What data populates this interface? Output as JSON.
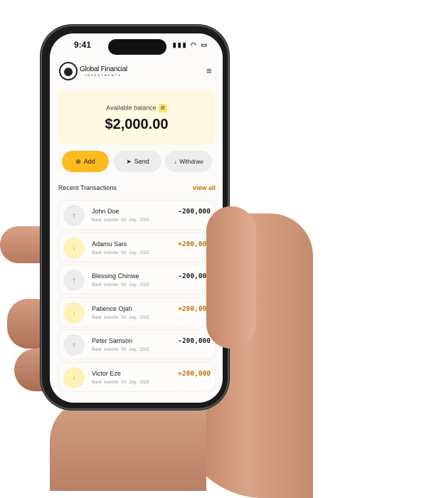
{
  "status": {
    "time": "9:41",
    "icons": "▮▮▮ ◠ ▭"
  },
  "header": {
    "brand": "Global Financial",
    "brand_sub": "INVESTMENTS"
  },
  "balance": {
    "label": "Available balance",
    "eye": "⊘",
    "amount": "$2,000.00"
  },
  "actions": {
    "add": "Add",
    "add_icon": "⊕",
    "send": "Send",
    "send_icon": "➤",
    "withdraw": "Withdraw",
    "withdraw_icon": "↓"
  },
  "recent": {
    "title": "Recent Transactions",
    "view_all": "view all"
  },
  "transactions": [
    {
      "name": "John Doe",
      "method": "Bank transfer",
      "date": "03 July, 2025",
      "amount": "-200,000",
      "dir": "↑"
    },
    {
      "name": "Adamu Sani",
      "method": "Bank transfer",
      "date": "03 July, 2025",
      "amount": "+200,000",
      "dir": "↓"
    },
    {
      "name": "Blessing Chinwe",
      "method": "Bank transfer",
      "date": "03 July, 2025",
      "amount": "-200,000",
      "dir": "↑"
    },
    {
      "name": "Patience Ojah",
      "method": "Bank transfer",
      "date": "03 July, 2025",
      "amount": "+200,000",
      "dir": "↓"
    },
    {
      "name": "Peter Samson",
      "method": "Bank transfer",
      "date": "03 July, 2025",
      "amount": "-200,000",
      "dir": "↑"
    },
    {
      "name": "Victor Eze",
      "method": "Bank transfer",
      "date": "03 July, 2025",
      "amount": "+200,000",
      "dir": "↓"
    }
  ]
}
